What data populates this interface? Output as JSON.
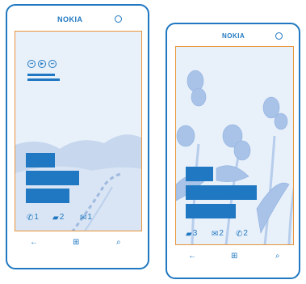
{
  "colors": {
    "accent": "#1f78c1",
    "screen_outline": "#e8953a",
    "screen_bg": "#e8f0fa"
  },
  "left_phone": {
    "brand": "NOKIA",
    "notifications": [
      {
        "icon": "phone-icon",
        "count": "1"
      },
      {
        "icon": "message-icon",
        "count": "2"
      },
      {
        "icon": "mail-icon",
        "count": "1"
      }
    ],
    "nav": {
      "back_icon": "back-arrow-icon",
      "start_icon": "windows-start-icon",
      "search_icon": "search-icon"
    },
    "media_controls": [
      "previous-icon",
      "play-icon",
      "next-icon"
    ]
  },
  "right_phone": {
    "brand": "NOKIA",
    "notifications": [
      {
        "icon": "message-icon",
        "count": "3"
      },
      {
        "icon": "mail-icon",
        "count": "2"
      },
      {
        "icon": "phone-icon",
        "count": "2"
      }
    ],
    "nav": {
      "back_icon": "back-arrow-icon",
      "start_icon": "windows-start-icon",
      "search_icon": "search-icon"
    }
  }
}
